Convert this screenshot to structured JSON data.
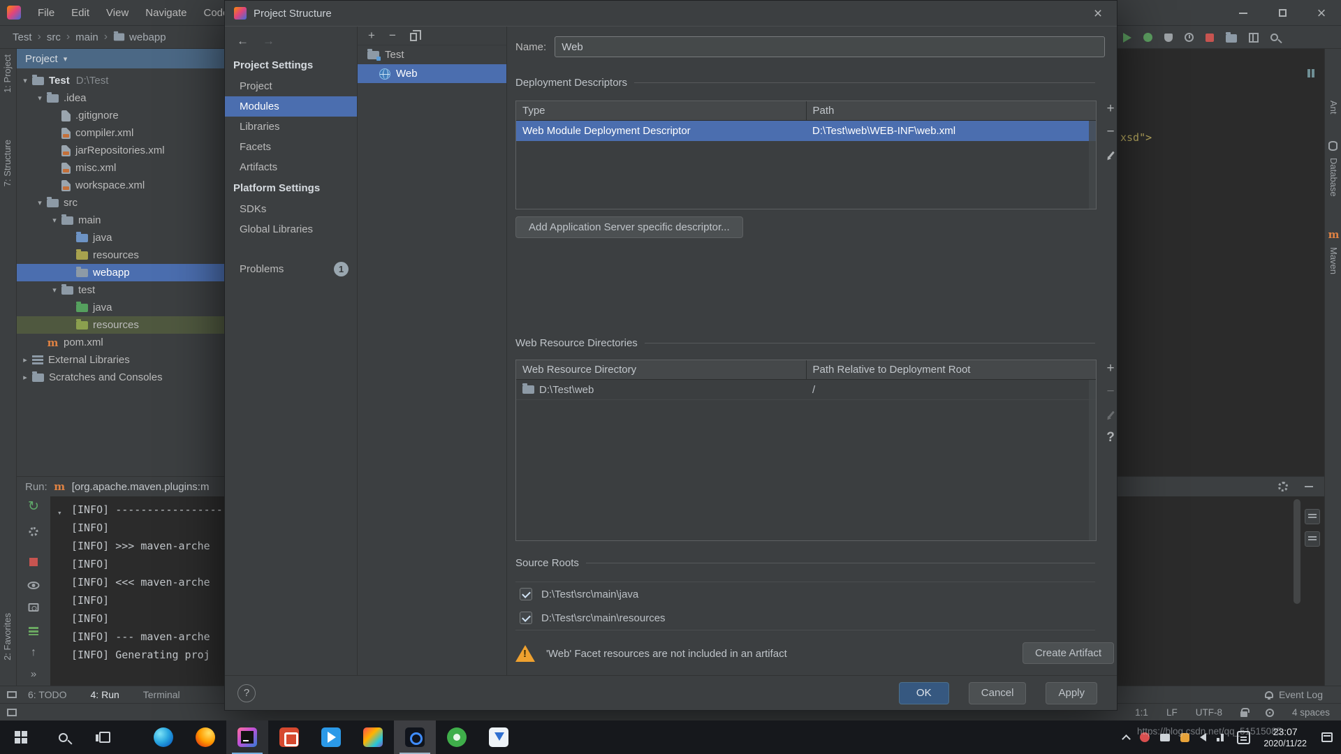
{
  "icons": {
    "close": "×",
    "back": "←",
    "forward": "→",
    "chevron_down": "▾",
    "chevron_right": "▸",
    "breadcrumb_sep": "›",
    "plus": "+",
    "minus": "−",
    "more": "»",
    "up": "↑",
    "rerun": "↻",
    "question": "?"
  },
  "window": {
    "menu_items": [
      "File",
      "Edit",
      "View",
      "Navigate",
      "Code"
    ],
    "breadcrumbs": [
      {
        "label": "Test"
      },
      {
        "label": "src"
      },
      {
        "label": "main"
      },
      {
        "label": "webapp",
        "icon": "folder"
      }
    ]
  },
  "left_stripe": {
    "project": "1: Project",
    "structure": "7: Structure",
    "favorites": "2: Favorites"
  },
  "right_stripe": {
    "ant": "Ant",
    "database": "Database",
    "maven": "Maven"
  },
  "project_panel": {
    "header": "Project",
    "tree": [
      {
        "label": "Test",
        "hint": "D:\\Test",
        "level": 0,
        "chevron": "down",
        "icon": "folder",
        "bold": true
      },
      {
        "label": ".idea",
        "level": 1,
        "chevron": "down",
        "icon": "folder"
      },
      {
        "label": ".gitignore",
        "level": 2,
        "icon": "file"
      },
      {
        "label": "compiler.xml",
        "level": 2,
        "icon": "file-xml"
      },
      {
        "label": "jarRepositories.xml",
        "level": 2,
        "icon": "file-xml"
      },
      {
        "label": "misc.xml",
        "level": 2,
        "icon": "file-xml"
      },
      {
        "label": "workspace.xml",
        "level": 2,
        "icon": "file-xml"
      },
      {
        "label": "src",
        "level": 1,
        "chevron": "down",
        "icon": "folder"
      },
      {
        "label": "main",
        "level": 2,
        "chevron": "down",
        "icon": "folder"
      },
      {
        "label": "java",
        "level": 3,
        "icon": "folder-source"
      },
      {
        "label": "resources",
        "level": 3,
        "icon": "folder-resources"
      },
      {
        "label": "webapp",
        "level": 3,
        "icon": "folder",
        "state": "selected"
      },
      {
        "label": "test",
        "level": 2,
        "chevron": "down",
        "icon": "folder"
      },
      {
        "label": "java",
        "level": 3,
        "icon": "folder-test"
      },
      {
        "label": "resources",
        "level": 3,
        "icon": "folder-test-resources",
        "state": "highlight"
      },
      {
        "label": "pom.xml",
        "level": 1,
        "icon": "maven"
      },
      {
        "label": "External Libraries",
        "level": 0,
        "chevron": "right",
        "icon": "libraries"
      },
      {
        "label": "Scratches and Consoles",
        "level": 0,
        "chevron": "right",
        "icon": "scratches"
      }
    ]
  },
  "run_panel": {
    "label": "Run:",
    "config": "[org.apache.maven.plugins:m",
    "console": [
      "[INFO] --------------------------------------------",
      "[INFO]",
      "[INFO] >>> maven-arche",
      "[INFO]",
      "[INFO] <<< maven-arche",
      "[INFO]",
      "[INFO]",
      "[INFO] --- maven-arche",
      "[INFO] Generating proj"
    ]
  },
  "editor": {
    "code_fragment": "xsd\">"
  },
  "bottom_bar": {
    "items": [
      {
        "label": "6: TODO"
      },
      {
        "label": "4: Run",
        "active": true
      },
      {
        "label": "Terminal"
      }
    ],
    "event_log": "Event Log"
  },
  "status_bar": {
    "caret": "1:1",
    "line_sep": "LF",
    "encoding": "UTF-8",
    "indent": "4 spaces"
  },
  "dialog": {
    "title": "Project Structure",
    "sidebar": {
      "sections": [
        {
          "header": "Project Settings",
          "items": [
            {
              "label": "Project"
            },
            {
              "label": "Modules",
              "selected": true
            },
            {
              "label": "Libraries"
            },
            {
              "label": "Facets"
            },
            {
              "label": "Artifacts"
            }
          ]
        },
        {
          "header": "Platform Settings",
          "items": [
            {
              "label": "SDKs"
            },
            {
              "label": "Global Libraries"
            }
          ]
        }
      ],
      "problems": {
        "label": "Problems",
        "badge": "1"
      }
    },
    "module_tree": [
      {
        "label": "Test",
        "icon": "module"
      },
      {
        "label": "Web",
        "icon": "web",
        "selected": true
      }
    ],
    "content": {
      "name_label": "Name:",
      "name_value": "Web",
      "sections": {
        "deployment": {
          "title": "Deployment Descriptors",
          "columns": [
            "Type",
            "Path"
          ],
          "rows": [
            {
              "cells": [
                "Web Module Deployment Descriptor",
                "D:\\Test\\web\\WEB-INF\\web.xml"
              ],
              "selected": true
            }
          ],
          "add_button": "Add Application Server specific descriptor..."
        },
        "web_resources": {
          "title": "Web Resource Directories",
          "columns": [
            "Web Resource Directory",
            "Path Relative to Deployment Root"
          ],
          "rows": [
            {
              "cells": [
                "D:\\Test\\web",
                "/"
              ],
              "icon": "folder"
            }
          ]
        },
        "source_roots": {
          "title": "Source Roots",
          "items": [
            {
              "label": "D:\\Test\\src\\main\\java",
              "checked": true
            },
            {
              "label": "D:\\Test\\src\\main\\resources",
              "checked": true
            }
          ]
        }
      },
      "warning": {
        "text": "'Web' Facet resources are not included in an artifact",
        "button": "Create Artifact"
      }
    },
    "footer": {
      "ok": "OK",
      "cancel": "Cancel",
      "apply": "Apply"
    }
  },
  "taskbar": {
    "apps": [
      "edge",
      "firefox",
      "intellij",
      "red-app",
      "vscode",
      "multicolor-app",
      "dark-app",
      "green-app",
      "blue-app"
    ],
    "clock": {
      "time": "23:07",
      "date": "2020/11/22"
    }
  },
  "watermark": "https://blog.csdn.net/qq_51515085"
}
